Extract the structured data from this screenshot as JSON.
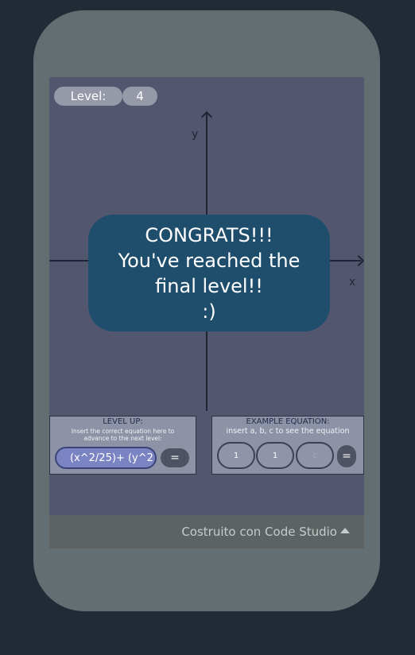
{
  "level": {
    "label": "Level:",
    "value": "4"
  },
  "graph": {
    "y_label": "y",
    "x_label": "x"
  },
  "congrats": {
    "line1": "CONGRATS!!!",
    "line2": "You've reached the",
    "line3": "final level!!",
    "line4": ":)"
  },
  "level_up": {
    "title": "LEVEL UP:",
    "hint_line1": "Insert the correct equation here to",
    "hint_line2": "advance to the next level:",
    "equation_value": "(x^2/25)+ (y^2",
    "submit_label": "="
  },
  "example": {
    "title": "EXAMPLE EQUATION:",
    "hint": "insert a, b, c to see the equation",
    "a_value": "1",
    "b_value": "1",
    "c_placeholder": "c",
    "submit_label": "="
  },
  "footer": {
    "text": "Costruito con Code Studio"
  },
  "colors": {
    "background": "#212b35",
    "phone": "#636e73",
    "screen": "#52576f",
    "congrats_bg": "#1f4e6c",
    "equation_input": "#7b84c2"
  },
  "icons": {
    "footer_caret": "caret-up-icon"
  }
}
